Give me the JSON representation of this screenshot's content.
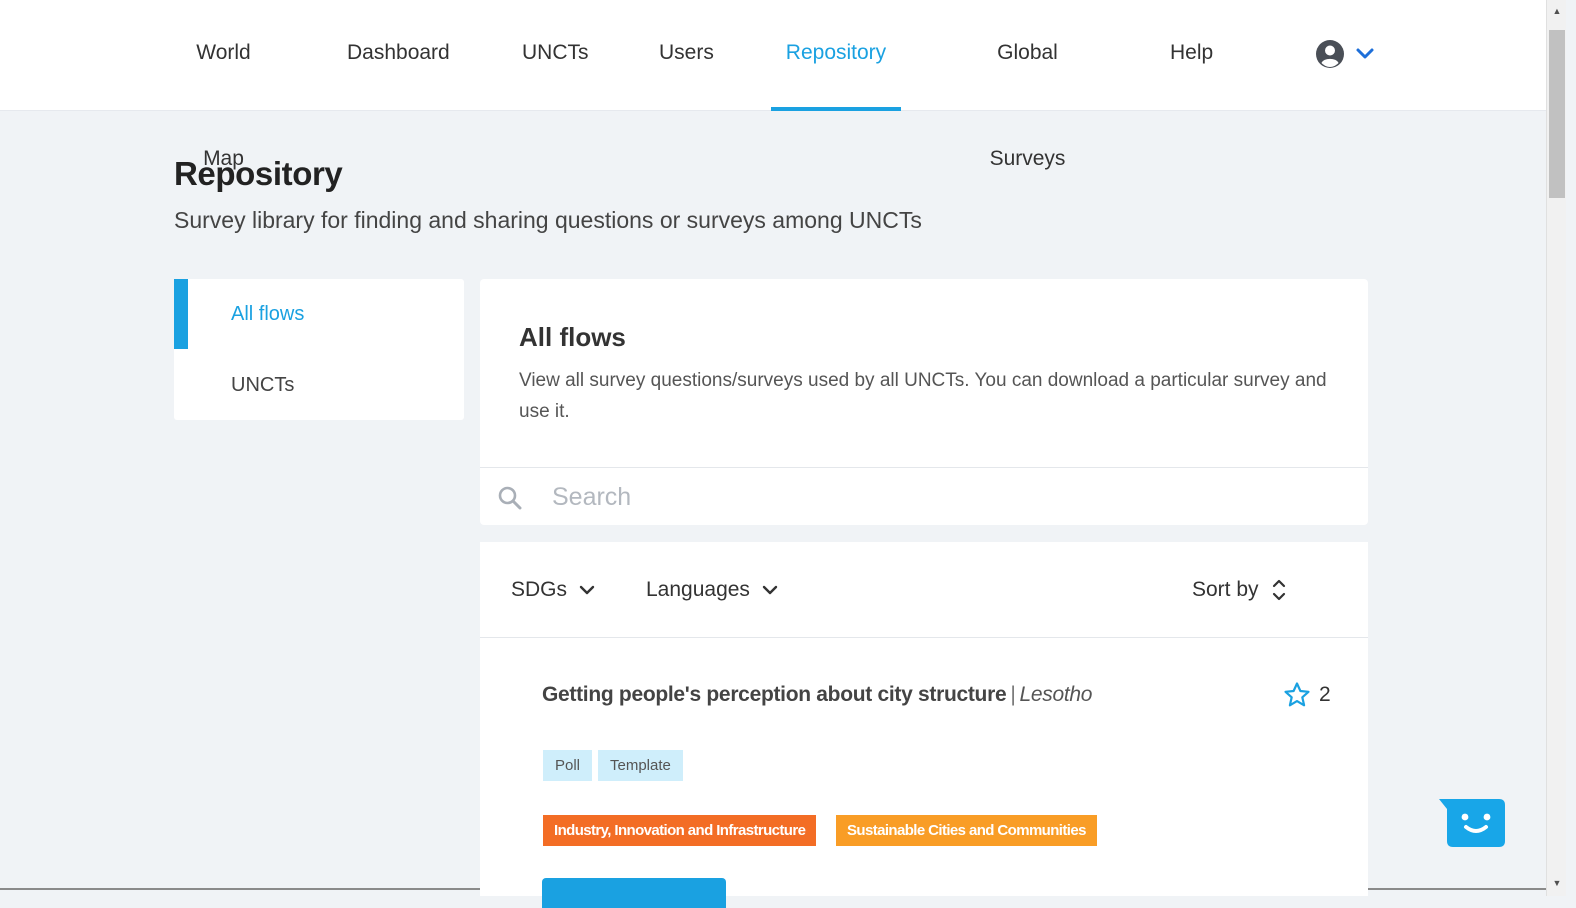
{
  "nav": {
    "items": [
      {
        "label": "World Map"
      },
      {
        "label": "Dashboard"
      },
      {
        "label": "UNCTs"
      },
      {
        "label": "Users"
      },
      {
        "label": "Repository"
      },
      {
        "label": "Global Surveys"
      },
      {
        "label": "Help"
      }
    ],
    "active": "Repository",
    "user_icon": "account-circle-icon"
  },
  "header": {
    "title": "Repository",
    "subtitle": "Survey library for finding and sharing questions or surveys among UNCTs"
  },
  "sidebar": {
    "items": [
      {
        "label": "All flows"
      },
      {
        "label": "UNCTs"
      }
    ],
    "active": "All flows"
  },
  "main": {
    "title": "All flows",
    "description": "View all survey questions/surveys used by all UNCTs. You can download a particular survey and use it.",
    "search": {
      "placeholder": "Search",
      "value": ""
    },
    "filters": {
      "sdgs": "SDGs",
      "languages": "Languages",
      "sort": "Sort by"
    },
    "results": [
      {
        "title": "Getting people's perception about city structure",
        "separator": "|",
        "country": "Lesotho",
        "stars": "2",
        "tags": [
          "Poll",
          "Template"
        ],
        "sdgs": [
          {
            "label": "Industry, Innovation and Infrastructure",
            "color": "#f36d25"
          },
          {
            "label": "Sustainable Cities and Communities",
            "color": "#f99d26"
          }
        ]
      }
    ]
  },
  "colors": {
    "accent": "#1aa1e1",
    "background": "#f0f3f6",
    "tag": "#cfeefb"
  }
}
